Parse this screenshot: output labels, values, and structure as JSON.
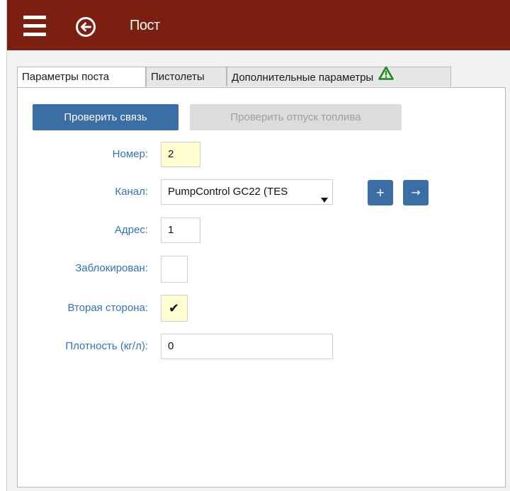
{
  "header": {
    "title": "Пост",
    "menu_icon": "hamburger-menu-icon",
    "back_icon": "back-arrow-circle-icon",
    "background": "#7b1f10"
  },
  "tabs": [
    {
      "label": "Параметры поста",
      "active": true
    },
    {
      "label": "Пистолеты",
      "active": false
    },
    {
      "label": "Дополнительные параметры",
      "active": false,
      "icon": "warning-triangle-icon",
      "icon_color": "#1a8a1a"
    }
  ],
  "actions": {
    "check_connection": "Проверить связь",
    "check_fuel": "Проверить отпуск топлива"
  },
  "form": {
    "number": {
      "label": "Номер:",
      "value": "2"
    },
    "channel": {
      "label": "Канал:",
      "value": "PumpControl GC22 (TES",
      "add_label": "+",
      "go_label": "→"
    },
    "address": {
      "label": "Адрес:",
      "value": "1"
    },
    "blocked": {
      "label": "Заблокирован:",
      "checked": false
    },
    "second_side": {
      "label": "Вторая сторона:",
      "checked": true,
      "mark": "✔"
    },
    "density": {
      "label": "Плотность (кг/л):",
      "value": "0"
    }
  },
  "colors": {
    "primary": "#3a6ea5",
    "label": "#3173c2",
    "highlight_field": "#ffffd2"
  }
}
